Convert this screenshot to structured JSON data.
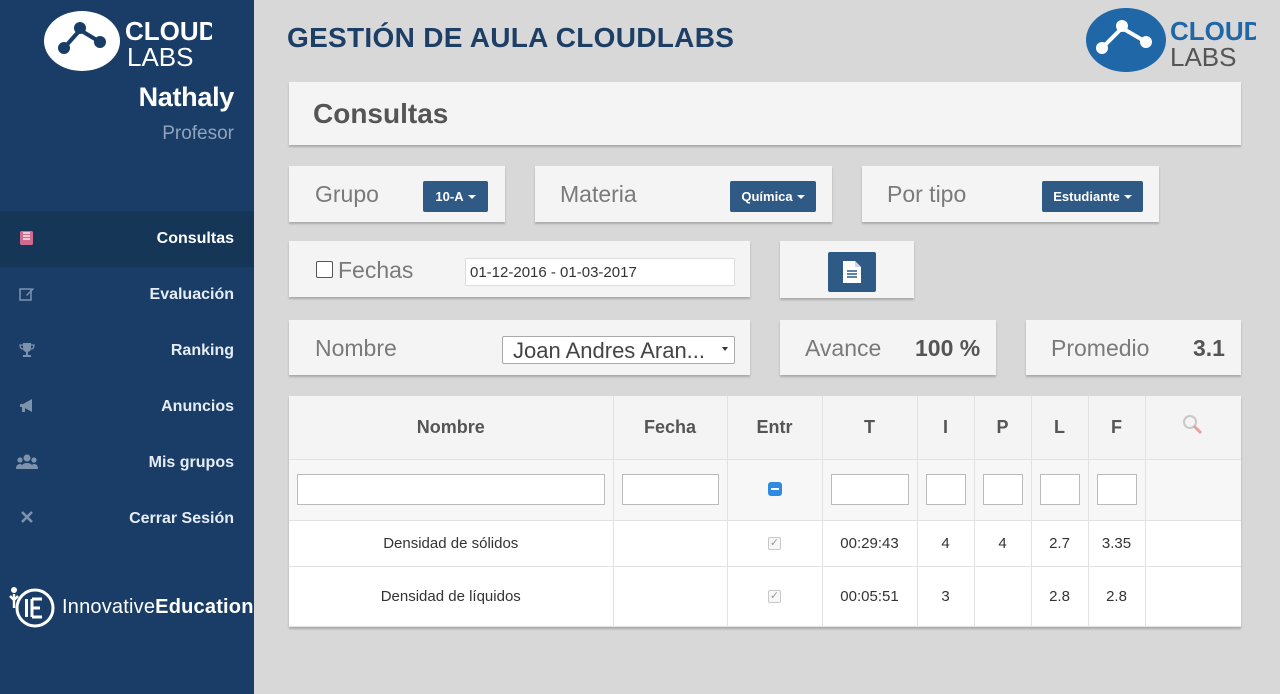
{
  "sidebar": {
    "logo_top": "CLOUD",
    "logo_bottom": "LABS",
    "user_name": "Nathaly",
    "user_role": "Profesor",
    "items": [
      {
        "label": "Consultas",
        "icon": "book-icon",
        "active": true
      },
      {
        "label": "Evaluación",
        "icon": "edit-icon",
        "active": false
      },
      {
        "label": "Ranking",
        "icon": "trophy-icon",
        "active": false
      },
      {
        "label": "Anuncios",
        "icon": "megaphone-icon",
        "active": false
      },
      {
        "label": "Mis grupos",
        "icon": "users-icon",
        "active": false
      },
      {
        "label": "Cerrar Sesión",
        "icon": "close-icon",
        "active": false
      }
    ],
    "brand_prefix": "Innovative",
    "brand_suffix": "Education"
  },
  "header": {
    "title": "GESTIÓN DE AULA CLOUDLABS",
    "logo_top": "CLOUD",
    "logo_bottom": "LABS"
  },
  "page": {
    "title": "Consultas"
  },
  "filters": {
    "group_label": "Grupo",
    "group_value": "10-A",
    "subject_label": "Materia",
    "subject_value": "Química",
    "type_label": "Por tipo",
    "type_value": "Estudiante",
    "dates_label": "Fechas",
    "dates_value": "01-12-2016 - 01-03-2017",
    "name_label": "Nombre",
    "name_value": "Joan Andres Aran...",
    "progress_label": "Avance",
    "progress_value": "100 %",
    "average_label": "Promedio",
    "average_value": "3.1"
  },
  "table": {
    "headers": [
      "Nombre",
      "Fecha",
      "Entr",
      "T",
      "I",
      "P",
      "L",
      "F"
    ],
    "rows": [
      {
        "nombre": "Densidad de sólidos",
        "fecha": "",
        "entr": true,
        "t": "00:29:43",
        "i": "4",
        "p": "4",
        "l": "2.7",
        "f": "3.35"
      },
      {
        "nombre": "Densidad de líquidos",
        "fecha": "",
        "entr": true,
        "t": "00:05:51",
        "i": "3",
        "p": "",
        "l": "2.8",
        "f": "2.8"
      }
    ]
  },
  "colors": {
    "sidebar": "#193d66",
    "accent_button": "#2f5a85",
    "title": "#1d3f66"
  }
}
